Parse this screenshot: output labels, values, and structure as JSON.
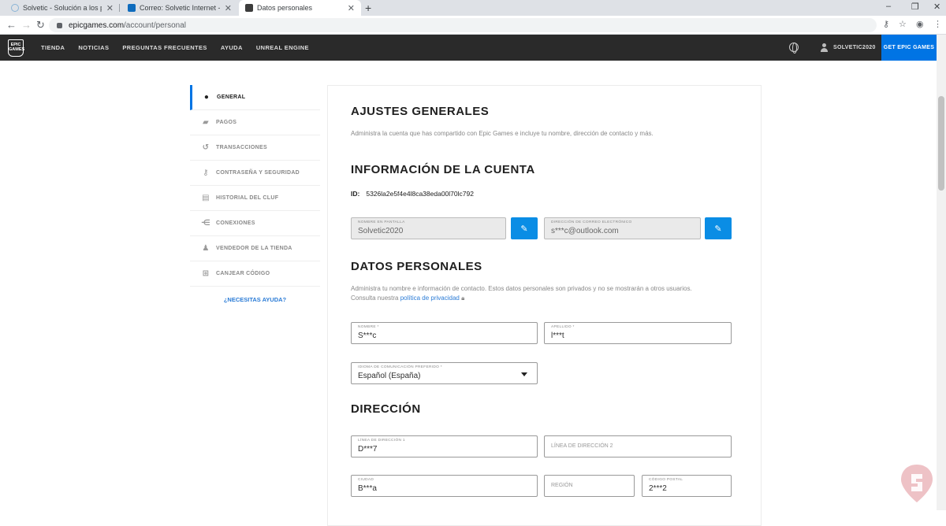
{
  "browser": {
    "tabs": [
      {
        "title": "Solvetic - Solución a los problem",
        "favicon_color": "#8ab4d6"
      },
      {
        "title": "Correo: Solvetic Internet - Outlo",
        "favicon_color": "#0f6cbd"
      },
      {
        "title": "Datos personales",
        "favicon_color": "#3c3c3c"
      }
    ],
    "new_tab": "+",
    "window_controls": [
      "–",
      "❐",
      "✕"
    ],
    "url_host": "epicgames.com",
    "url_path": "/account/personal"
  },
  "epic_nav": {
    "logo_text": "EPIC GAMES",
    "links": [
      "TIENDA",
      "NOTICIAS",
      "PREGUNTAS FRECUENTES",
      "AYUDA",
      "UNREAL ENGINE"
    ],
    "username": "SOLVETIC2020",
    "cta": "GET EPIC GAMES"
  },
  "sidebar": {
    "items": [
      {
        "label": "GENERAL",
        "icon": "user-icon",
        "glyph": "●",
        "active": true
      },
      {
        "label": "PAGOS",
        "icon": "payment-icon",
        "glyph": "▰",
        "active": false
      },
      {
        "label": "TRANSACCIONES",
        "icon": "history-icon",
        "glyph": "↺",
        "active": false
      },
      {
        "label": "CONTRASEÑA Y SEGURIDAD",
        "icon": "key-icon",
        "glyph": "⚷",
        "active": false
      },
      {
        "label": "HISTORIAL DEL CLUF",
        "icon": "clipboard-icon",
        "glyph": "▤",
        "active": false
      },
      {
        "label": "CONEXIONES",
        "icon": "share-icon",
        "glyph": "⋲",
        "active": false
      },
      {
        "label": "VENDEDOR DE LA TIENDA",
        "icon": "seller-icon",
        "glyph": "♟",
        "active": false
      },
      {
        "label": "CANJEAR CÓDIGO",
        "icon": "gift-icon",
        "glyph": "⊞",
        "active": false
      }
    ],
    "help": "¿NECESITAS AYUDA?"
  },
  "main": {
    "general_title": "AJUSTES GENERALES",
    "general_desc": "Administra la cuenta que has compartido con Epic Games e incluye tu nombre, dirección de contacto y más.",
    "account_title": "INFORMACIÓN DE LA CUENTA",
    "id_label": "ID:",
    "id_value": "5326la2e5f4e4l8ca38eda00l70lc792",
    "display_name_label": "NOMBRE EN PANTALLA",
    "display_name": "Solvetic2020",
    "email_label": "DIRECCIÓN DE CORREO ELECTRÓNICO",
    "email": "s***c@outlook.com",
    "edit_glyph": "✎",
    "personal_title": "DATOS PERSONALES",
    "personal_desc_1": "Administra tu nombre e información de contacto. Estos datos personales son privados y no se mostrarán a otros usuarios.",
    "personal_desc_2": "Consulta nuestra",
    "privacy_link": "política de privacidad",
    "first_name_label": "NOMBRE *",
    "first_name": "S***c",
    "last_name_label": "APELLIDO *",
    "last_name": "l***t",
    "language_label": "IDIOMA DE COMUNICACIÓN PREFERIDO *",
    "language": "Español (España)",
    "address_title": "DIRECCIÓN",
    "address1_label": "LÍNEA DE DIRECCIÓN 1",
    "address1": "D***7",
    "address2_placeholder": "LÍNEA DE DIRECCIÓN 2",
    "city_label": "CIUDAD",
    "city": "B***a",
    "region_placeholder": "REGIÓN",
    "postal_label": "CÓDIGO POSTAL",
    "postal": "2***2"
  }
}
